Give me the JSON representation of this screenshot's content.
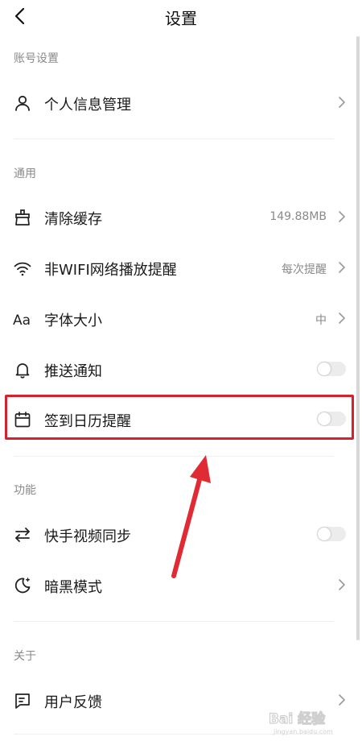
{
  "header": {
    "title": "设置"
  },
  "sections": {
    "account": "账号设置",
    "general": "通用",
    "feature": "功能",
    "about": "关于"
  },
  "rows": {
    "personal": {
      "label": "个人信息管理"
    },
    "cache": {
      "label": "清除缓存",
      "value": "149.88MB"
    },
    "wifi": {
      "label": "非WIFI网络播放提醒",
      "value": "每次提醒"
    },
    "font": {
      "label": "字体大小",
      "value": "中"
    },
    "push": {
      "label": "推送通知",
      "enabled": false
    },
    "checkin": {
      "label": "签到日历提醒",
      "enabled": false
    },
    "sync": {
      "label": "快手视频同步",
      "enabled": false
    },
    "dark": {
      "label": "暗黑模式"
    },
    "feedback": {
      "label": "用户反馈"
    }
  },
  "icons": {
    "personal": "person-icon",
    "cache": "broom-icon",
    "wifi": "wifi-icon",
    "font": "font-size-icon",
    "push": "bell-icon",
    "checkin": "calendar-icon",
    "sync": "swap-arrows-icon",
    "dark": "moon-icon",
    "feedback": "feedback-icon"
  },
  "annotation": {
    "highlight_color": "#d6222d"
  },
  "watermark": {
    "text": "Bai 经验"
  }
}
